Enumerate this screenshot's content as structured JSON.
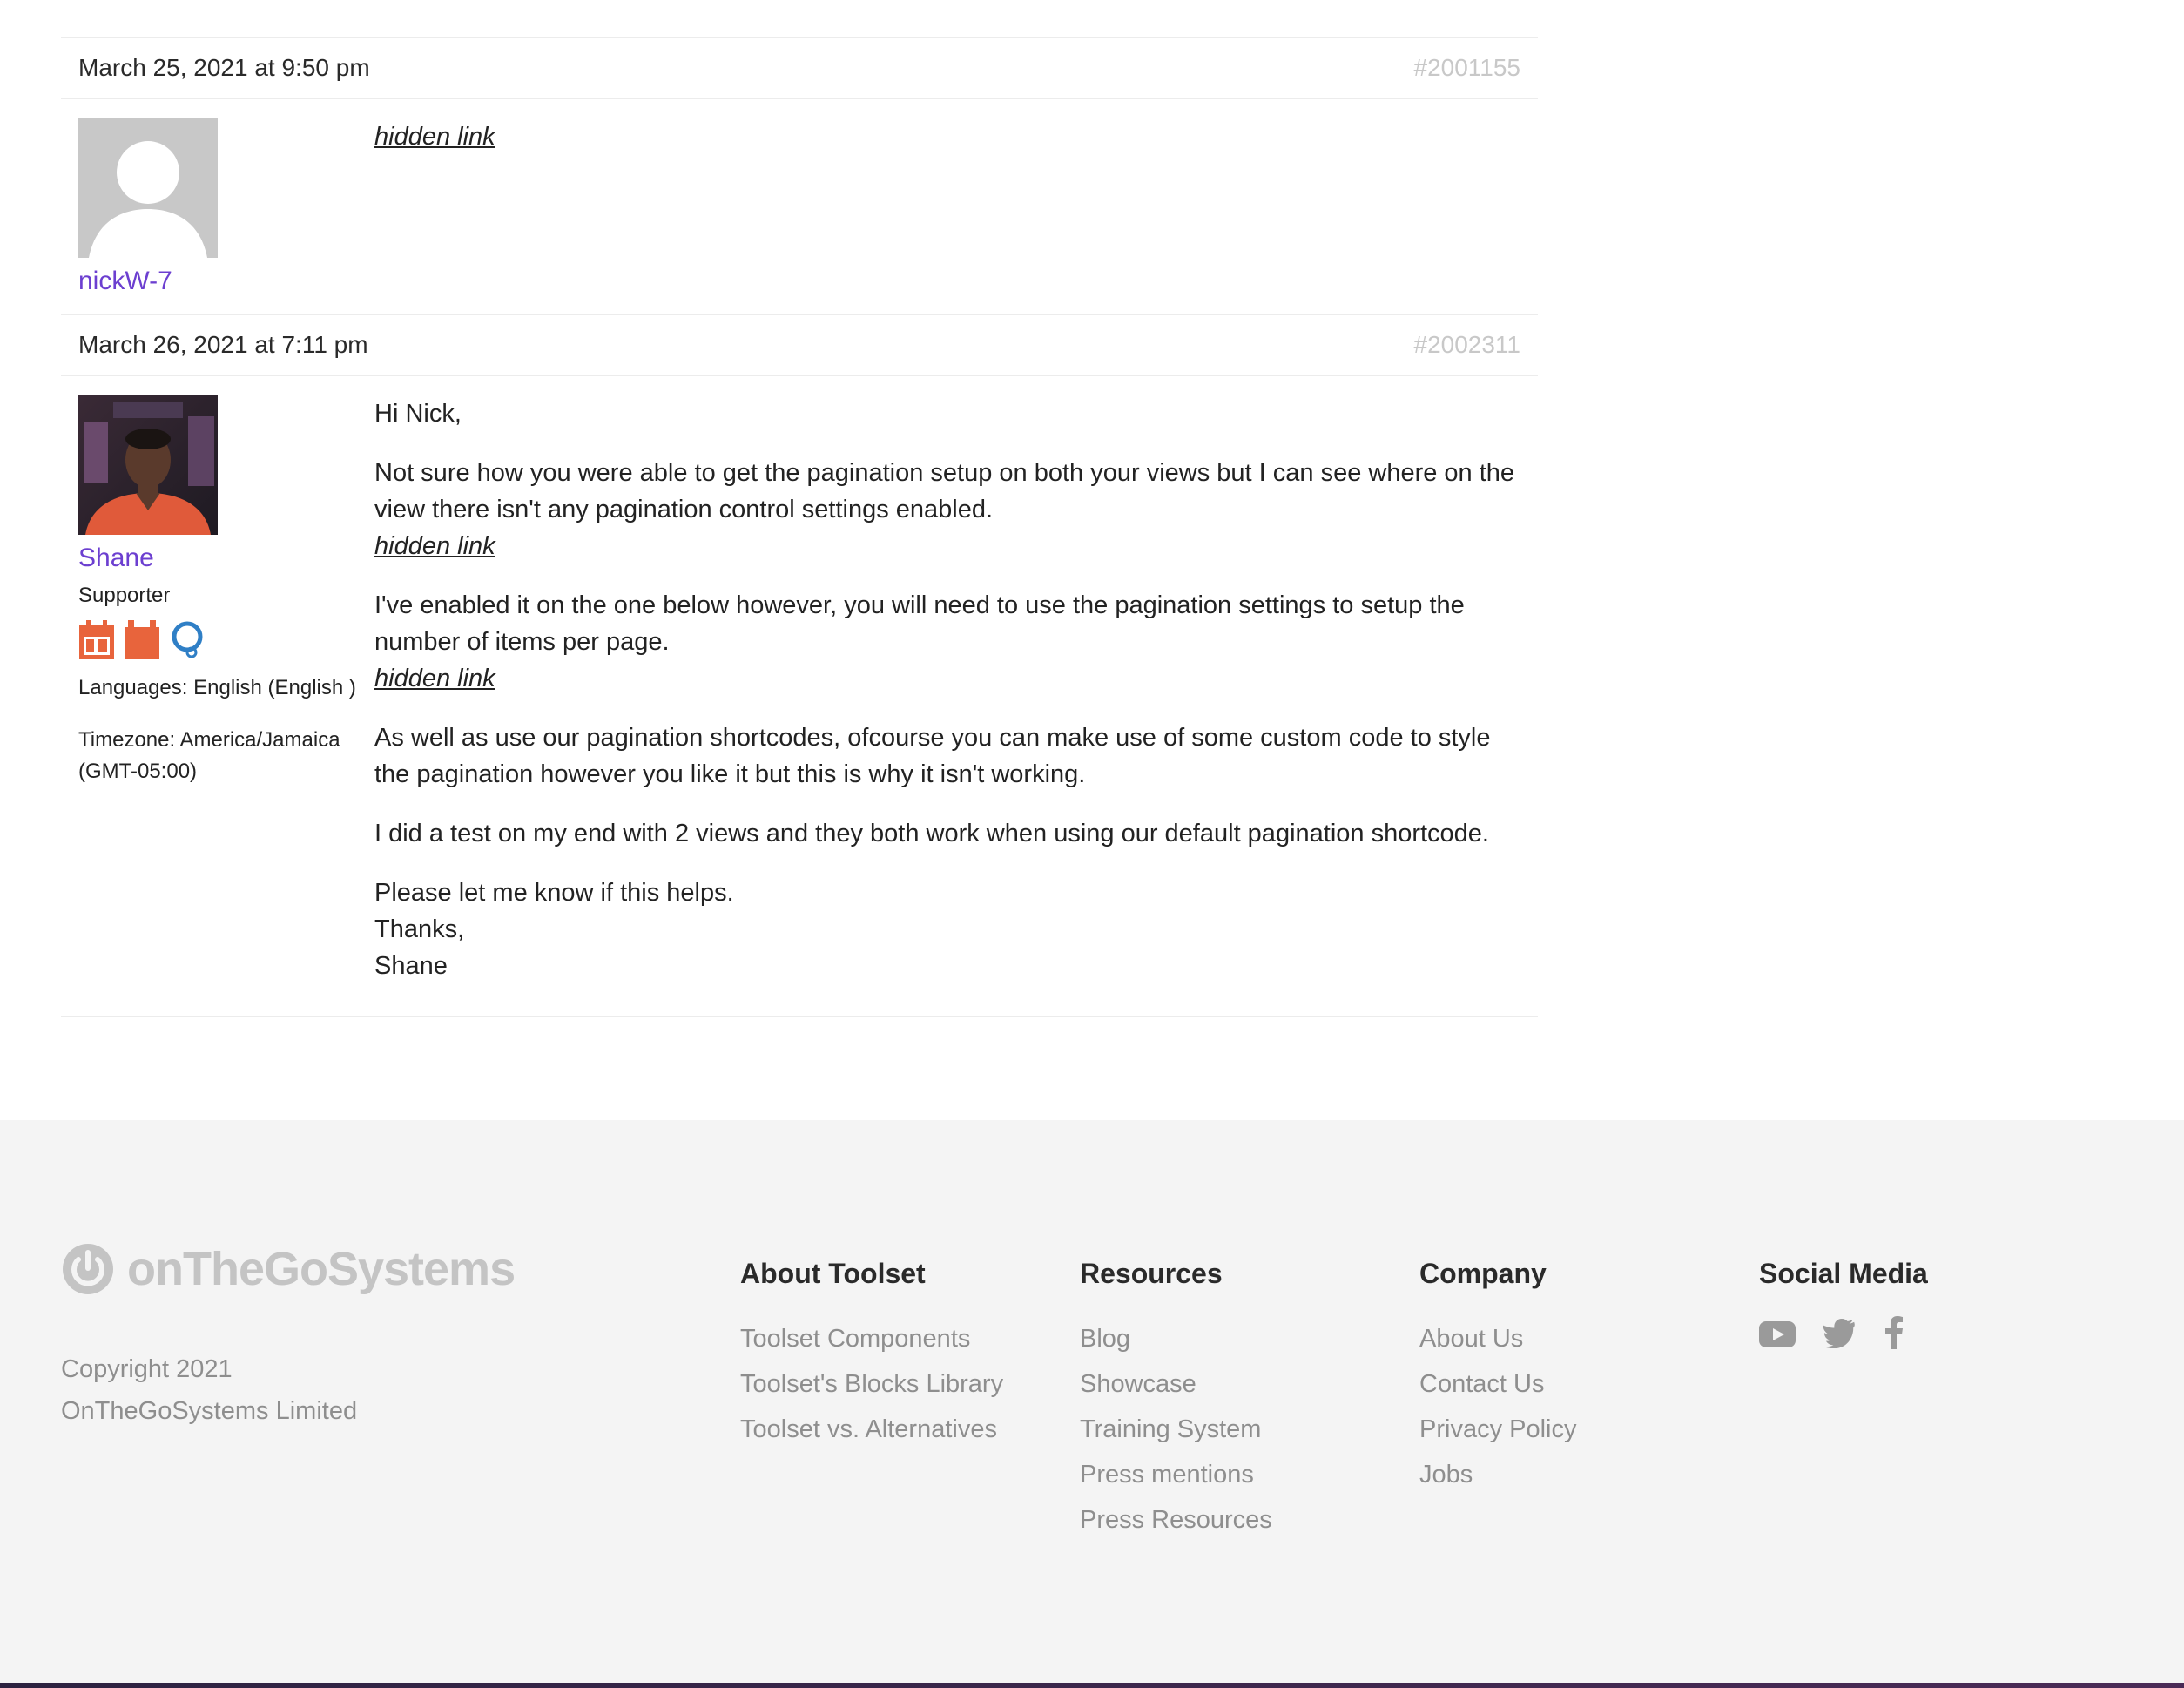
{
  "posts": [
    {
      "date": "March 25, 2021 at 9:50 pm",
      "id": "#2001155",
      "author": {
        "name": "nickW-7"
      },
      "paragraphs": [
        {
          "text": "",
          "link": "hidden link"
        }
      ]
    },
    {
      "date": "March 26, 2021 at 7:11 pm",
      "id": "#2002311",
      "author": {
        "name": "Shane",
        "role": "Supporter",
        "languages": "Languages: English (English )",
        "timezone": "Timezone: America/Jamaica (GMT-05:00)"
      },
      "paragraphs": [
        {
          "text": "Hi Nick,",
          "link": ""
        },
        {
          "text": "Not sure how you were able to get the pagination setup on both your views but I can see where on the view there isn't any pagination control settings enabled.",
          "link": "hidden link"
        },
        {
          "text": "I've enabled it on the one below however, you will need to use the pagination settings to setup the number of items per page.",
          "link": "hidden link"
        },
        {
          "text": "As well as use our pagination shortcodes, ofcourse you can make use of some custom code to style the pagination however you like it but this is why it isn't working.",
          "link": ""
        },
        {
          "text": "I did a test on my end with 2 views and they both work when using our default pagination shortcode.",
          "link": ""
        },
        {
          "lines": [
            "Please let me know if this helps.",
            "Thanks,",
            "Shane"
          ]
        }
      ]
    }
  ],
  "footer": {
    "brand": "onTheGoSystems",
    "copyright_line1": "Copyright 2021",
    "copyright_line2": "OnTheGoSystems Limited",
    "columns": [
      {
        "title": "About Toolset",
        "links": [
          "Toolset Components",
          "Toolset's Blocks Library",
          "Toolset vs. Alternatives"
        ]
      },
      {
        "title": "Resources",
        "links": [
          "Blog",
          "Showcase",
          "Training System",
          "Press mentions",
          "Press Resources"
        ]
      },
      {
        "title": "Company",
        "links": [
          "About Us",
          "Contact Us",
          "Privacy Policy",
          "Jobs"
        ]
      },
      {
        "title": "Social Media",
        "icons": [
          "youtube-icon",
          "twitter-icon",
          "facebook-icon"
        ]
      }
    ]
  },
  "colors": {
    "author_link": "#6c3fd0",
    "badge_orange": "#e8643c",
    "badge_blue": "#2f7fc6",
    "footer_bg": "#f4f4f4",
    "footer_link": "#8e8e8e"
  }
}
